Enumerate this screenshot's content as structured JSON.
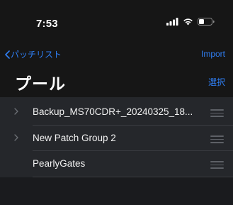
{
  "status_bar": {
    "time": "7:53",
    "icons": [
      "cellular-signal-icon",
      "wifi-icon",
      "battery-icon"
    ]
  },
  "nav": {
    "back_label": "パッチリスト",
    "import_label": "Import",
    "select_label": "選択",
    "title": "プール"
  },
  "pool": {
    "rows": [
      {
        "label": "Backup_MS70CDR+_20240325_18...",
        "has_chevron": true
      },
      {
        "label": "New Patch Group 2",
        "has_chevron": true
      },
      {
        "label": "PearlyGates",
        "has_chevron": false
      }
    ]
  },
  "colors": {
    "accent": "#2f7ff5",
    "background": "#161616",
    "list_background": "#25272b",
    "text": "#ffffff"
  }
}
